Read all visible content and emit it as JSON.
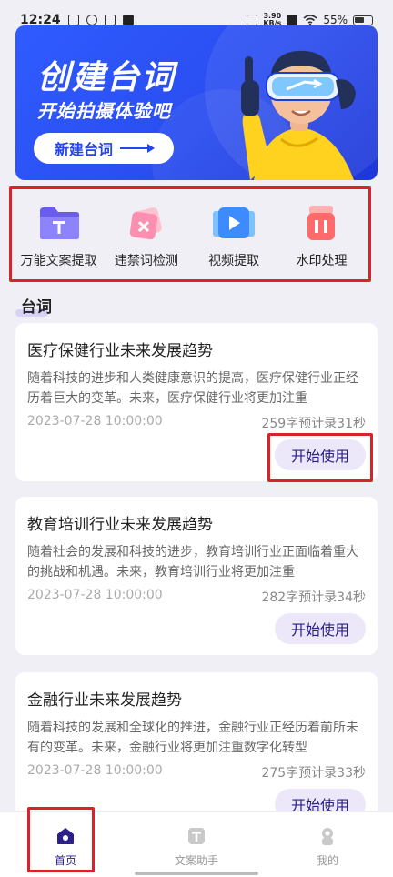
{
  "status_bar": {
    "time": "12:24",
    "net_speed_value": "3.90",
    "net_speed_unit": "KB/s",
    "battery": "55%"
  },
  "banner": {
    "title": "创建台词",
    "subtitle": "开始拍摄体验吧",
    "button_label": "新建台词"
  },
  "tools": [
    {
      "label": "万能文案提取",
      "icon": "folder-text-icon"
    },
    {
      "label": "违禁词检测",
      "icon": "prohibited-word-icon"
    },
    {
      "label": "视频提取",
      "icon": "video-play-icon"
    },
    {
      "label": "水印处理",
      "icon": "watermark-icon"
    }
  ],
  "section": {
    "title": "台词"
  },
  "cards": [
    {
      "title": "医疗保健行业未来发展趋势",
      "desc": "随着科技的进步和人类健康意识的提高，医疗保健行业正经历着巨大的变革。未来，医疗保健行业将更加注重",
      "date": "2023-07-28 10:00:00",
      "meta": "259字预计录31秒",
      "button": "开始使用"
    },
    {
      "title": "教育培训行业未来发展趋势",
      "desc": "随着社会的发展和科技的进步，教育培训行业正面临着重大的挑战和机遇。未来，教育培训行业将更加注重",
      "date": "2023-07-28 10:00:00",
      "meta": "282字预计录34秒",
      "button": "开始使用"
    },
    {
      "title": "金融行业未来发展趋势",
      "desc": "随着科技的发展和全球化的推进，金融行业正经历着前所未有的变革。未来，金融行业将更加注重数字化转型",
      "date": "2023-07-28 10:00:00",
      "meta": "275字预计录33秒",
      "button": "开始使用"
    }
  ],
  "nav": [
    {
      "label": "首页",
      "icon": "home-icon",
      "active": true
    },
    {
      "label": "文案助手",
      "icon": "text-assistant-icon",
      "active": false
    },
    {
      "label": "我的",
      "icon": "profile-icon",
      "active": false
    }
  ],
  "colors": {
    "accent": "#2b1f8a",
    "banner_blue": "#2a4df0",
    "highlight_red": "#d7242b",
    "button_bg": "#ece8fa"
  }
}
